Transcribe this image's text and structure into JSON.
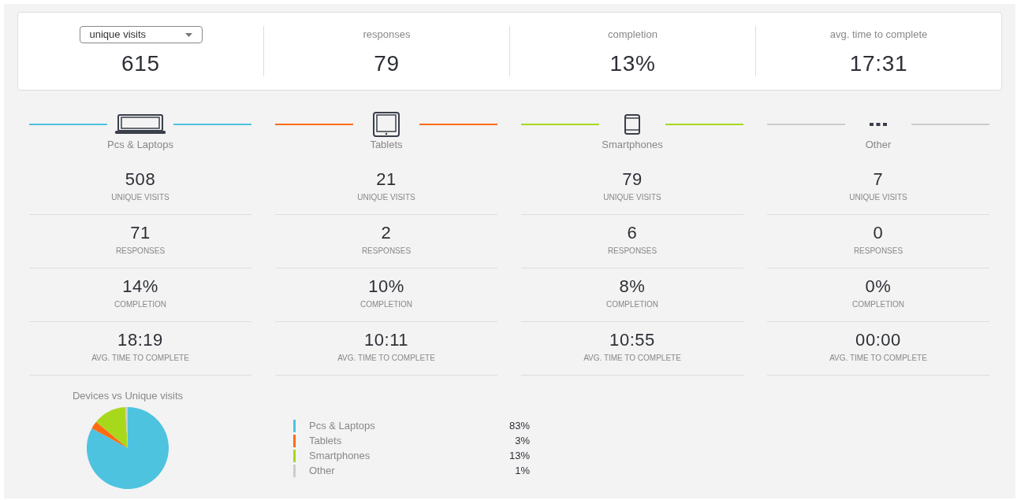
{
  "summary": [
    {
      "kind": "dropdown",
      "label": "unique visits",
      "value": "615"
    },
    {
      "kind": "plain",
      "label": "responses",
      "value": "79"
    },
    {
      "kind": "plain",
      "label": "completion",
      "value": "13%"
    },
    {
      "kind": "plain",
      "label": "avg. time to complete",
      "value": "17:31"
    }
  ],
  "devices": [
    {
      "name": "Pcs & Laptops",
      "kind": "laptop",
      "color": "#4dc3e0",
      "stats": [
        {
          "value": "508",
          "label": "UNIQUE VISITS"
        },
        {
          "value": "71",
          "label": "RESPONSES"
        },
        {
          "value": "14%",
          "label": "COMPLETION"
        },
        {
          "value": "18:19",
          "label": "AVG. TIME TO COMPLETE"
        }
      ]
    },
    {
      "name": "Tablets",
      "kind": "tablet",
      "color": "#ff6a13",
      "stats": [
        {
          "value": "21",
          "label": "UNIQUE VISITS"
        },
        {
          "value": "2",
          "label": "RESPONSES"
        },
        {
          "value": "10%",
          "label": "COMPLETION"
        },
        {
          "value": "10:11",
          "label": "AVG. TIME TO COMPLETE"
        }
      ]
    },
    {
      "name": "Smartphones",
      "kind": "phone",
      "color": "#a8d81c",
      "stats": [
        {
          "value": "79",
          "label": "UNIQUE VISITS"
        },
        {
          "value": "6",
          "label": "RESPONSES"
        },
        {
          "value": "8%",
          "label": "COMPLETION"
        },
        {
          "value": "10:55",
          "label": "AVG. TIME TO COMPLETE"
        }
      ]
    },
    {
      "name": "Other",
      "kind": "other",
      "color": "#cccccc",
      "stats": [
        {
          "value": "7",
          "label": "UNIQUE VISITS"
        },
        {
          "value": "0",
          "label": "RESPONSES"
        },
        {
          "value": "0%",
          "label": "COMPLETION"
        },
        {
          "value": "00:00",
          "label": "AVG. TIME TO COMPLETE"
        }
      ]
    }
  ],
  "chart": {
    "chart_data": {
      "type": "pie",
      "title": "Devices vs Unique visits",
      "categories": [
        "Pcs & Laptops",
        "Tablets",
        "Smartphones",
        "Other"
      ],
      "values": [
        83,
        3,
        13,
        1
      ]
    },
    "legend": [
      {
        "value": "83%",
        "color": "#4dc3e0"
      },
      {
        "value": "3%",
        "color": "#ff6a13"
      },
      {
        "value": "13%",
        "color": "#a8d81c"
      },
      {
        "value": "1%",
        "color": "#cccccc"
      }
    ]
  }
}
